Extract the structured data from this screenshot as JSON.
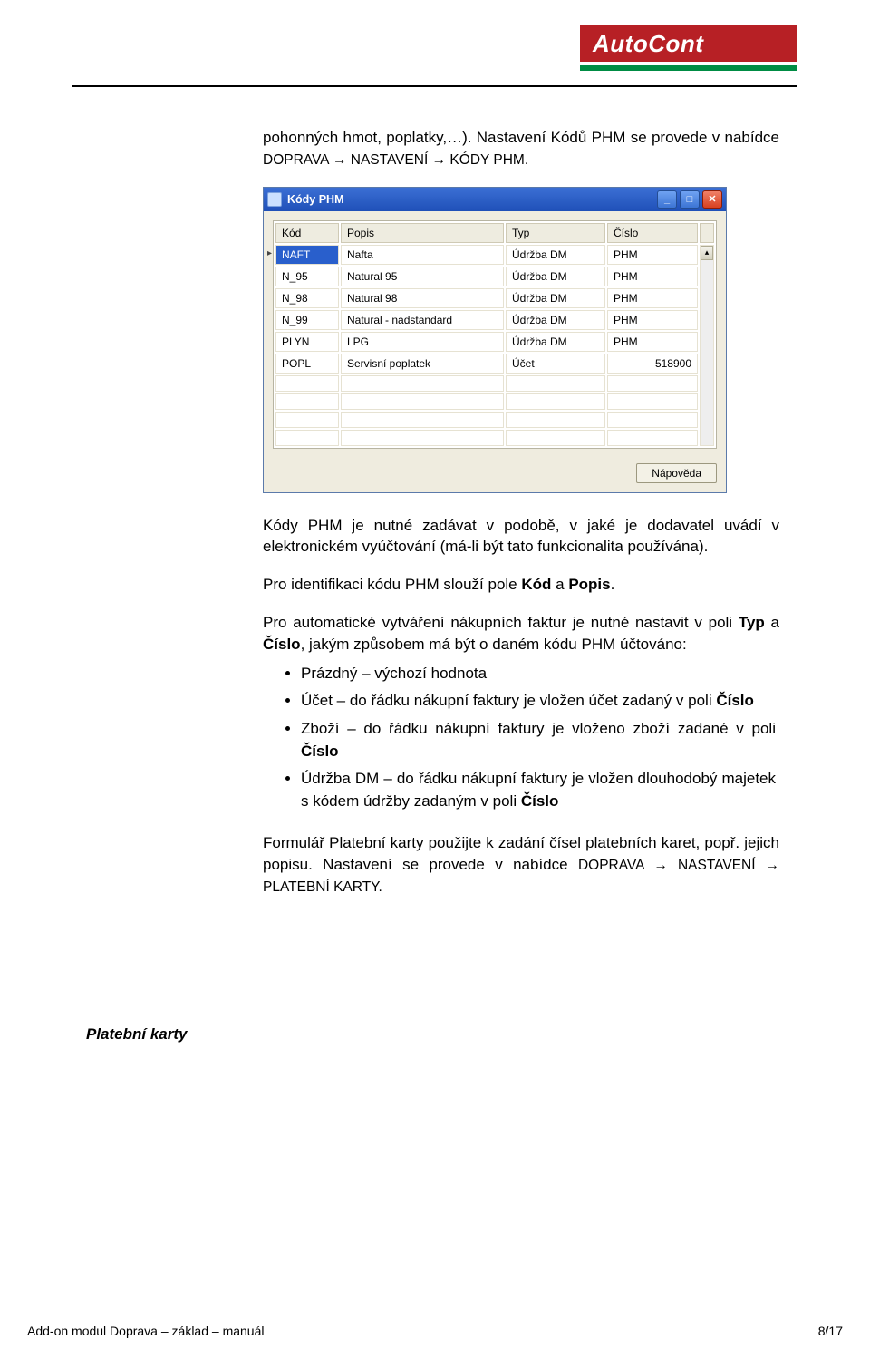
{
  "logo": {
    "text": "AutoCont"
  },
  "intro": {
    "prefix": "pohonných hmot, poplatky,…). Nastavení Kódů PHM se provede v nabídce ",
    "menu1": "DOPRAVA → NASTAVENÍ → KÓDY PHM."
  },
  "shot": {
    "title": "Kódy PHM",
    "headers": [
      "Kód",
      "Popis",
      "Typ",
      "Číslo"
    ],
    "rows": [
      [
        "NAFT",
        "Nafta",
        "Údržba DM",
        "PHM"
      ],
      [
        "N_95",
        "Natural 95",
        "Údržba DM",
        "PHM"
      ],
      [
        "N_98",
        "Natural 98",
        "Údržba DM",
        "PHM"
      ],
      [
        "N_99",
        "Natural - nadstandard",
        "Údržba DM",
        "PHM"
      ],
      [
        "PLYN",
        "LPG",
        "Údržba DM",
        "PHM"
      ],
      [
        "POPL",
        "Servisní poplatek",
        "Účet",
        "518900"
      ]
    ],
    "button": "Nápověda"
  },
  "p2a": "Kódy PHM je nutné zadávat v podobě, v jaké je dodavatel uvádí v elektronickém vyúčtování (má-li být tato funkcionalita používána).",
  "p3_pre": "Pro identifikaci kódu PHM slouží pole ",
  "p3_b1": "Kód",
  "p3_mid": " a ",
  "p3_b2": "Popis",
  "p3_end": ".",
  "p4_pre": "Pro automatické vytváření nákupních faktur je nutné nastavit v poli ",
  "p4_b1": "Typ",
  "p4_mid": " a ",
  "p4_b2": "Číslo",
  "p4_post": ", jakým způsobem má být o daném kódu PHM účtováno:",
  "bullets": {
    "b1": "Prázdný – výchozí hodnota",
    "b2_pre": "Účet – do řádku nákupní faktury je vložen účet zadaný v poli ",
    "b2_b": "Číslo",
    "b3_pre": "Zboží – do řádku nákupní faktury je vloženo zboží zadané v poli ",
    "b3_b": "Číslo",
    "b4_pre": "Údržba DM – do řádku nákupní faktury je vložen dlouhodobý majetek s kódem údržby zadaným v poli ",
    "b4_b": "Číslo"
  },
  "side": "Platební karty",
  "p5_pre": "Formulář Platební karty použijte k zadání čísel platebních karet, popř. jejich popisu. Nastavení se provede v nabídce ",
  "p5_menu": "DOPRAVA → NASTAVENÍ → PLATEBNÍ KARTY.",
  "footer": {
    "left": "Add-on modul Doprava – základ – manuál",
    "right": "8/17"
  }
}
